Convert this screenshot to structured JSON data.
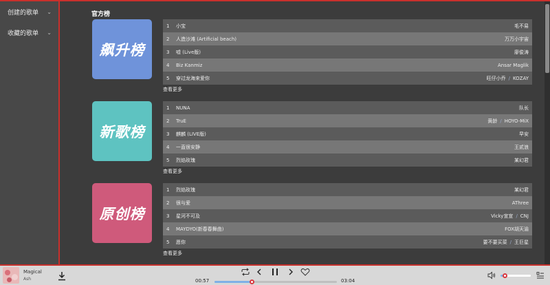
{
  "sidebar": {
    "items": [
      {
        "label": "创建的歌单",
        "chevron": "⌄"
      },
      {
        "label": "收藏的歌单",
        "chevron": "⌄"
      }
    ]
  },
  "main": {
    "section_title": "官方榜",
    "more_label": "查看更多",
    "charts": [
      {
        "cover_text": "飙升榜",
        "cover_color": "#6f93da",
        "tracks": [
          {
            "num": "1",
            "name": "小宝",
            "artists": [
              "毛不易"
            ]
          },
          {
            "num": "2",
            "name": "人造沙滩 (Artificial beach)",
            "artists": [
              "万万小宇宙"
            ]
          },
          {
            "num": "3",
            "name": "嘘 (Live版)",
            "artists": [
              "廖俊涛"
            ]
          },
          {
            "num": "4",
            "name": "Biz Kanmiz",
            "artists": [
              "Ansar Maglik"
            ]
          },
          {
            "num": "5",
            "name": "穿过龙海来爱你",
            "artists": [
              "旺仔小乔",
              "KOZAY"
            ]
          }
        ]
      },
      {
        "cover_text": "新歌榜",
        "cover_color": "#5ec3c1",
        "tracks": [
          {
            "num": "1",
            "name": "NUNA",
            "artists": [
              "队长"
            ]
          },
          {
            "num": "2",
            "name": "TruE",
            "artists": [
              "黄龄",
              "HOYO-MiX"
            ]
          },
          {
            "num": "3",
            "name": "麒麟 (LIVE版)",
            "artists": [
              "早安"
            ]
          },
          {
            "num": "4",
            "name": "一直很安静",
            "artists": [
              "王贰浪"
            ]
          },
          {
            "num": "5",
            "name": "烈焰玫瑰",
            "artists": [
              "某幻君"
            ]
          }
        ]
      },
      {
        "cover_text": "原创榜",
        "cover_color": "#cf5a7b",
        "tracks": [
          {
            "num": "1",
            "name": "烈焰玫瑰",
            "artists": [
              "某幻君"
            ]
          },
          {
            "num": "2",
            "name": "很与爱",
            "artists": [
              "AThree"
            ]
          },
          {
            "num": "3",
            "name": "星河不可及",
            "artists": [
              "Vicky宣宣",
              "CNJ"
            ]
          },
          {
            "num": "4",
            "name": "MAYDYO(新春春舞曲)",
            "artists": [
              "FOX胡天渝"
            ]
          },
          {
            "num": "5",
            "name": "愿你",
            "artists": [
              "要不要买菜",
              "王巨星"
            ]
          }
        ]
      }
    ]
  },
  "player": {
    "song_title": "Magical",
    "song_artist": "Ash",
    "current_time": "00:57",
    "total_time": "03:04",
    "progress_fraction": 0.31,
    "volume_fraction": 0.15,
    "icons": {
      "download": "download-icon",
      "loop": "loop-icon",
      "prev": "previous-icon",
      "pause": "pause-icon",
      "next": "next-icon",
      "like": "heart-icon",
      "volume": "volume-icon",
      "playlist": "playlist-icon"
    }
  },
  "colors": {
    "accent": "#c9302c",
    "progress": "#7fb0e6",
    "separator": "#9aa9c9"
  }
}
